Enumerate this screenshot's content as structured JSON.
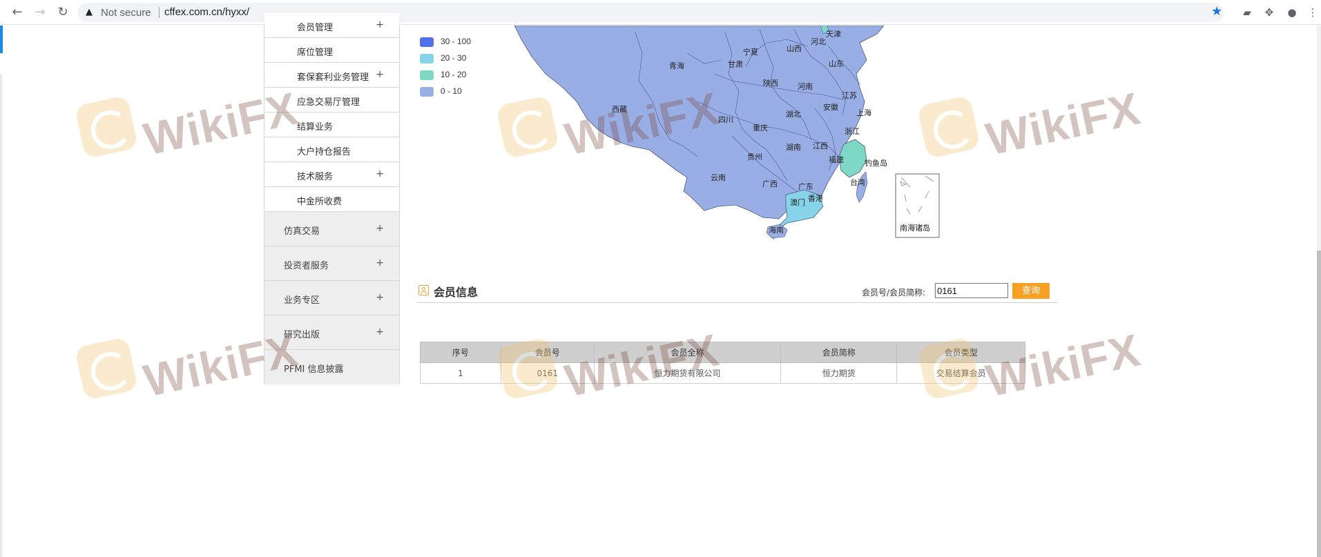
{
  "browser": {
    "security_label": "Not secure",
    "url": "cffex.com.cn/hyxx/"
  },
  "sidebar": {
    "sub_items": [
      {
        "label": "会员管理",
        "has_plus": true
      },
      {
        "label": "席位管理",
        "has_plus": false
      },
      {
        "label": "套保套利业务管理",
        "has_plus": true
      },
      {
        "label": "应急交易厅管理",
        "has_plus": false
      },
      {
        "label": "结算业务",
        "has_plus": false
      },
      {
        "label": "大户持仓报告",
        "has_plus": false
      },
      {
        "label": "技术服务",
        "has_plus": true
      },
      {
        "label": "中金所收费",
        "has_plus": false
      }
    ],
    "main_items": [
      {
        "label": "仿真交易",
        "has_plus": true
      },
      {
        "label": "投资者服务",
        "has_plus": true
      },
      {
        "label": "业务专区",
        "has_plus": true
      },
      {
        "label": "研究出版",
        "has_plus": true
      },
      {
        "label": "PFMI 信息披露",
        "has_plus": false
      }
    ],
    "plus_symbol": "+"
  },
  "legend": [
    {
      "label": "30 - 100",
      "color": "#5470e6"
    },
    {
      "label": "20 - 30",
      "color": "#87d3ea"
    },
    {
      "label": "10 - 20",
      "color": "#7dd8c6"
    },
    {
      "label": "0 - 10",
      "color": "#9aaee6"
    }
  ],
  "map": {
    "provinces": [
      "天津",
      "河北",
      "宁夏",
      "山西",
      "青海",
      "甘肃",
      "山东",
      "陕西",
      "河南",
      "江苏",
      "西藏",
      "安徽",
      "上海",
      "湖北",
      "四川",
      "重庆",
      "浙江",
      "湖南",
      "江西",
      "贵州",
      "福建",
      "钓鱼岛",
      "云南",
      "台湾",
      "广西",
      "广东",
      "香港",
      "澳门",
      "海南",
      "南海诸岛"
    ]
  },
  "member_section": {
    "title": "会员信息",
    "search_label": "会员号/会员简称:",
    "search_value": "0161",
    "search_button": "查询"
  },
  "table": {
    "headers": [
      "序号",
      "会员号",
      "会员全称",
      "会员简称",
      "会员类型"
    ],
    "rows": [
      [
        "1",
        "0161",
        "恒力期货有限公司",
        "恒力期货",
        "交易结算会员"
      ]
    ]
  },
  "watermark": {
    "text": "WikiFX"
  }
}
